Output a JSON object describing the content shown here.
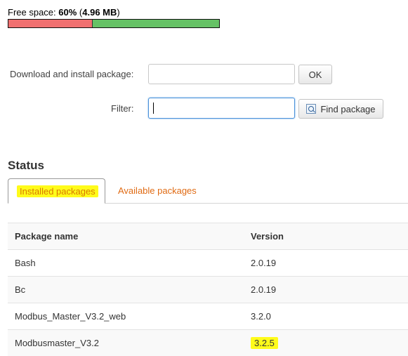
{
  "storage": {
    "label": "Free space:",
    "percent_text": "60%",
    "size_text": "4.96 MB",
    "used_fraction": 0.4,
    "used_color": "#f07070",
    "free_color": "#66c266"
  },
  "install": {
    "label": "Download and install package:",
    "value": "",
    "button_label": "OK"
  },
  "filter": {
    "label": "Filter:",
    "value": "",
    "button_label": "Find package"
  },
  "status": {
    "heading": "Status",
    "tabs": [
      {
        "label": "Installed packages",
        "active": true,
        "highlighted": true
      },
      {
        "label": "Available packages",
        "active": false
      }
    ]
  },
  "table": {
    "columns": [
      "Package name",
      "Version"
    ],
    "rows": [
      {
        "name": "Bash",
        "version": "2.0.19"
      },
      {
        "name": "Bc",
        "version": "2.0.19"
      },
      {
        "name": "Modbus_Master_V3.2_web",
        "version": "3.2.0"
      },
      {
        "name": "Modbusmaster_V3.2",
        "version": "3.2.5",
        "highlighted": true
      }
    ]
  },
  "colors": {
    "accent_orange": "#e06b14",
    "highlight_yellow": "#fffb1a",
    "focus_blue": "#4a90d9"
  }
}
